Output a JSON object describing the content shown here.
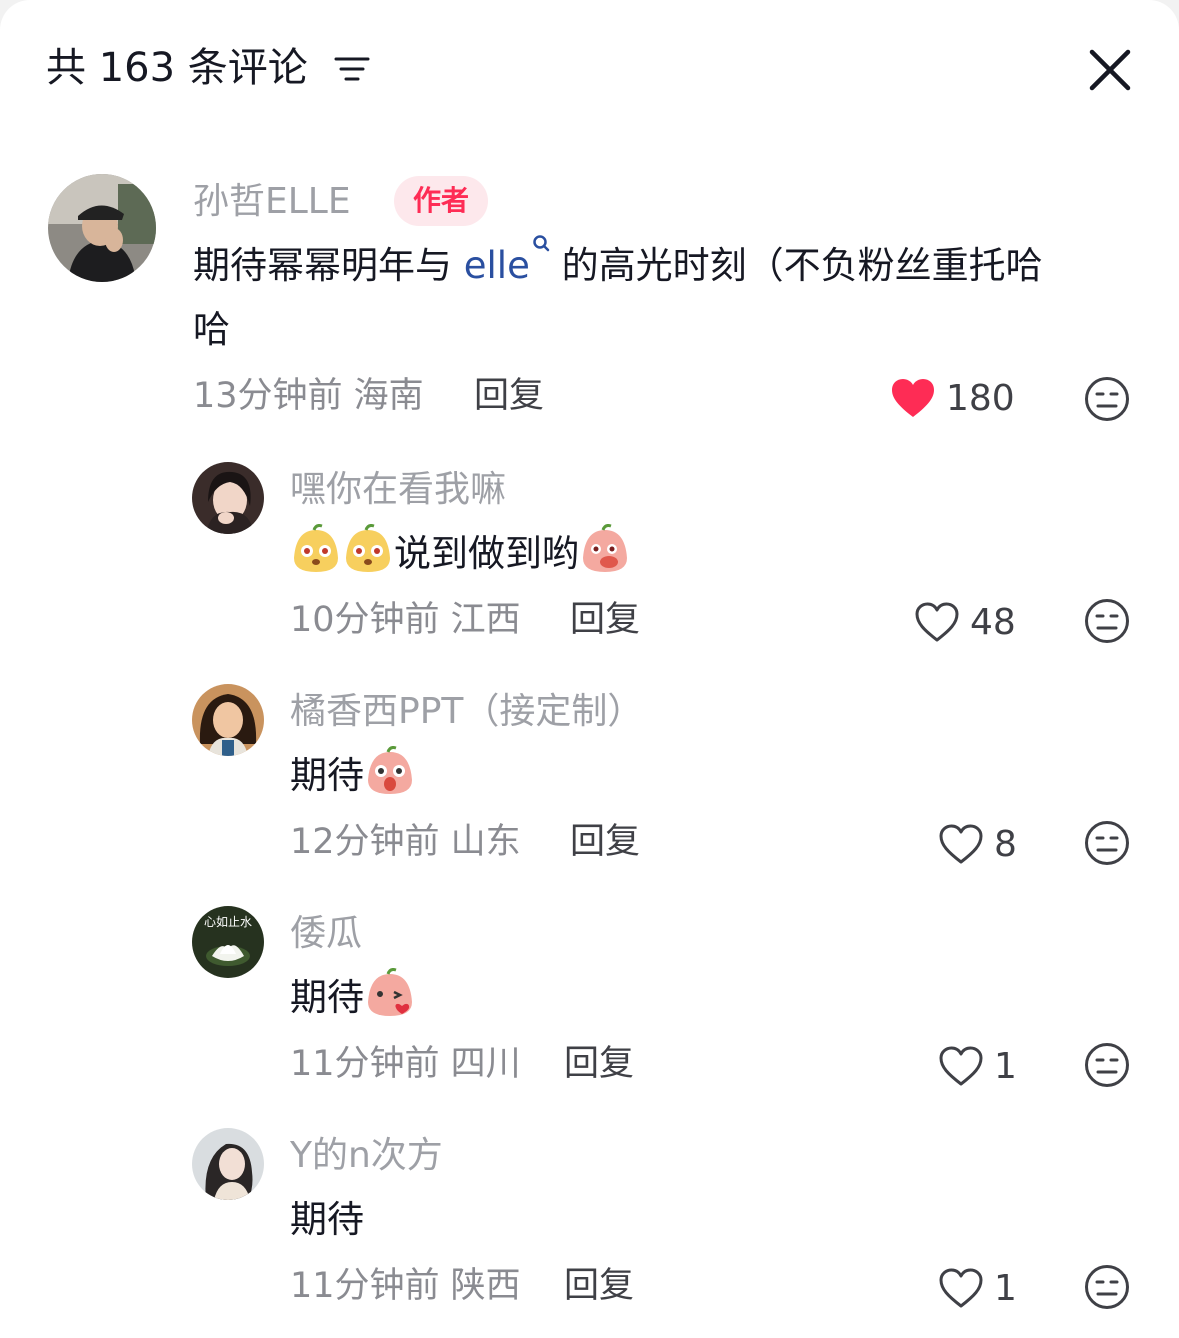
{
  "header": {
    "title": "共 163 条评论"
  },
  "comments": [
    {
      "username": "孙哲ELLE",
      "badge": "作者",
      "text_before": "期待幂幂明年与 ",
      "mention": "elle",
      "text_after": " 的高光时刻（不负粉丝重托哈",
      "text_line2": "哈",
      "time_location": "13分钟前 海南",
      "reply_label": "回复",
      "likes": "180",
      "liked": true
    },
    {
      "username": "嘿你在看我嘛",
      "text": "说到做到哟",
      "time_location": "10分钟前 江西",
      "reply_label": "回复",
      "likes": "48",
      "liked": false
    },
    {
      "username": "橘香西PPT（接定制）",
      "text": "期待",
      "time_location": "12分钟前 山东",
      "reply_label": "回复",
      "likes": "8",
      "liked": false
    },
    {
      "username": "倭瓜",
      "avatar_text": "心如止水",
      "text": "期待",
      "time_location": "11分钟前 四川",
      "reply_label": "回复",
      "likes": "1",
      "liked": false
    },
    {
      "username": "Y的n次方",
      "text": "期待",
      "time_location": "11分钟前 陕西",
      "reply_label": "回复",
      "likes": "1",
      "liked": false
    }
  ],
  "colors": {
    "accent": "#fe2c55",
    "username": "#9ea0a6",
    "meta": "#8a8b91",
    "mention": "#2a4fa0"
  },
  "icons": [
    "sort-icon",
    "close-icon",
    "heart-icon",
    "dislike-icon",
    "emoji-sticker-icon",
    "search-icon"
  ]
}
